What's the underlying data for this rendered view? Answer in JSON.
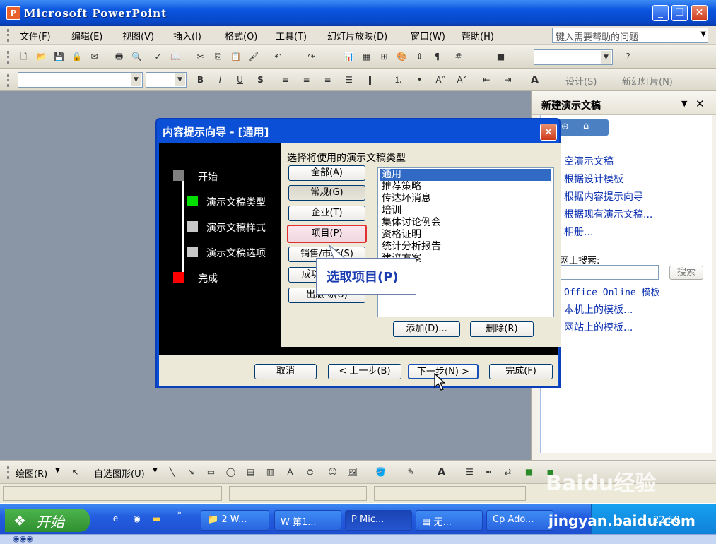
{
  "app": {
    "title": "Microsoft PowerPoint",
    "icon_letter": "P"
  },
  "window_buttons": {
    "minimize": "_",
    "restore": "❐",
    "close": "✕"
  },
  "menubar": {
    "items": [
      "文件(F)",
      "编辑(E)",
      "视图(V)",
      "插入(I)",
      "格式(O)",
      "工具(T)",
      "幻灯片放映(D)",
      "窗口(W)",
      "帮助(H)"
    ],
    "help_placeholder": "键入需要帮助的问题"
  },
  "format_toolbar": {
    "design": "设计(S)",
    "new_slide": "新幻灯片(N)",
    "bold": "B",
    "italic": "I",
    "underline": "U",
    "shadow": "S",
    "font_color": "A"
  },
  "taskpane": {
    "title": "新建演示文稿",
    "links": [
      "空演示文稿",
      "根据设计模板",
      "根据内容提示向导",
      "根据现有演示文稿...",
      "相册..."
    ],
    "search_label": "网上搜索:",
    "search_button": "搜索",
    "template_links": [
      "Office Online 模板",
      "本机上的模板...",
      "网站上的模板..."
    ]
  },
  "dialog": {
    "title": "内容提示向导 - [通用]",
    "close": "✕",
    "steps": [
      {
        "label": "开始",
        "color": "#808080"
      },
      {
        "label": "演示文稿类型",
        "color": "#00e000"
      },
      {
        "label": "演示文稿样式",
        "color": "#c8c8c8"
      },
      {
        "label": "演示文稿选项",
        "color": "#c8c8c8"
      },
      {
        "label": "完成",
        "color": "#ff0000"
      }
    ],
    "prompt": "选择将使用的演示文稿类型",
    "categories": [
      "全部(A)",
      "常规(G)",
      "企业(T)",
      "项目(P)",
      "销售/市场(S)",
      "成功指导(C)",
      "出版物(U)"
    ],
    "list_items": [
      "通用",
      "推荐策略",
      "传达坏消息",
      "培训",
      "集体讨论例会",
      "资格证明",
      "统计分析报告",
      "建议方案"
    ],
    "add_button": "添加(D)...",
    "delete_button": "删除(R)",
    "cancel": "取消",
    "back": "< 上一步(B)",
    "next": "下一步(N) >",
    "finish": "完成(F)"
  },
  "callout": "选取项目(P)",
  "drawbar": {
    "draw": "绘图(R)",
    "autoshapes": "自选图形(U)",
    "font_color": "A"
  },
  "taskbar": {
    "start": "开始",
    "tasks": [
      "2 W...",
      "第1...",
      "Mic...",
      "无...",
      "Ado..."
    ],
    "clock": "22:50"
  },
  "watermark": {
    "brand": "Baidu经验",
    "url": "jingyan.baidu.com"
  }
}
